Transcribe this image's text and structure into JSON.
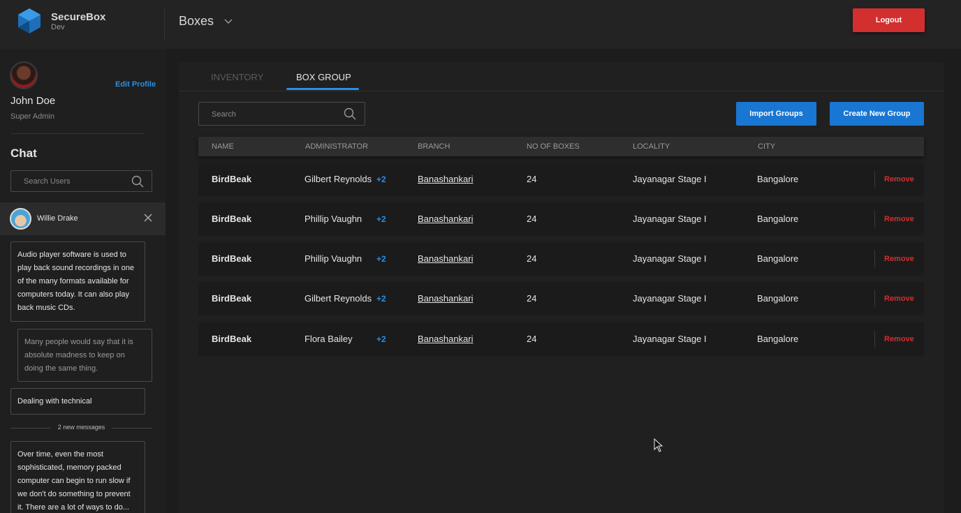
{
  "brand": {
    "name": "SecureBox",
    "env": "Dev",
    "logo_icon": "securebox-logo-icon"
  },
  "profile": {
    "edit_label": "Edit Profile",
    "name": "John Doe",
    "role": "Super Admin"
  },
  "chat": {
    "title": "Chat",
    "search_placeholder": "Search Users",
    "active_user": "Willie Drake",
    "messages": [
      {
        "direction": "in",
        "text": "Audio player software is used to play back sound recordings in one of the many formats available for computers today. It can also play back music CDs."
      },
      {
        "direction": "out",
        "text": "Many people would say that it is absolute madness to keep on doing the same thing."
      },
      {
        "direction": "in",
        "text": "Dealing with technical"
      },
      {
        "direction": "in",
        "text": "Over time, even the most sophisticated, memory packed computer can begin to run slow if we don't do something to prevent it. There are a lot of ways to do..."
      }
    ],
    "new_messages_label": "2 new messages"
  },
  "topbar": {
    "title": "Boxes",
    "logout_label": "Logout"
  },
  "tabs": [
    {
      "label": "INVENTORY",
      "active": false
    },
    {
      "label": "BOX GROUP",
      "active": true
    }
  ],
  "toolbar": {
    "search_placeholder": "Search",
    "import_label": "Import Groups",
    "create_label": "Create New Group"
  },
  "colors": {
    "accent": "#2a8fe6",
    "danger": "#d32f2f",
    "background": "#1c1c1c"
  },
  "table": {
    "columns": [
      "NAME",
      "ADMINISTRATOR",
      "BRANCH",
      "NO OF BOXES",
      "LOCALITY",
      "CITY"
    ],
    "remove_label": "Remove",
    "rows": [
      {
        "name": "BirdBeak",
        "administrator": "Gilbert Reynolds",
        "extra": "+2",
        "branch": "Banashankari",
        "boxes": "24",
        "locality": "Jayanagar Stage I",
        "city": "Bangalore"
      },
      {
        "name": "BirdBeak",
        "administrator": "Phillip Vaughn",
        "extra": "+2",
        "branch": "Banashankari",
        "boxes": "24",
        "locality": "Jayanagar Stage I",
        "city": "Bangalore"
      },
      {
        "name": "BirdBeak",
        "administrator": "Phillip Vaughn",
        "extra": "+2",
        "branch": "Banashankari",
        "boxes": "24",
        "locality": "Jayanagar Stage I",
        "city": "Bangalore"
      },
      {
        "name": "BirdBeak",
        "administrator": "Gilbert Reynolds",
        "extra": "+2",
        "branch": "Banashankari",
        "boxes": "24",
        "locality": "Jayanagar Stage I",
        "city": "Bangalore"
      },
      {
        "name": "BirdBeak",
        "administrator": "Flora Bailey",
        "extra": "+2",
        "branch": "Banashankari",
        "boxes": "24",
        "locality": "Jayanagar Stage I",
        "city": "Bangalore"
      }
    ]
  }
}
